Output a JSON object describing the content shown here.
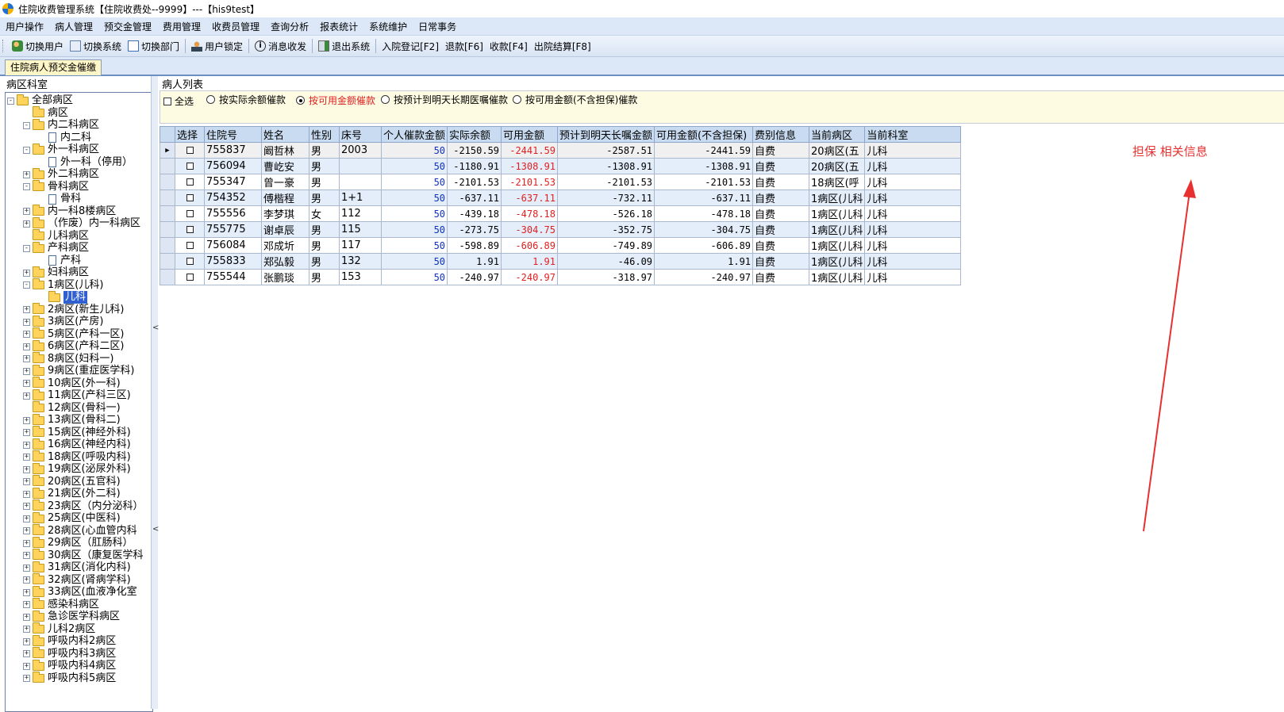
{
  "window": {
    "title": "住院收费管理系统【住院收费处--9999】---【his9test】"
  },
  "menu": [
    "用户操作",
    "病人管理",
    "预交金管理",
    "费用管理",
    "收费员管理",
    "查询分析",
    "报表统计",
    "系统维护",
    "日常事务"
  ],
  "toolbar": {
    "switch_user": "切换用户",
    "switch_system": "切换系统",
    "switch_dept": "切换部门",
    "lock_user": "用户锁定",
    "message": "消息收发",
    "exit_system": "退出系统",
    "admission": "入院登记[F2]",
    "refund": "退款[F6]",
    "charge": "收款[F4]",
    "discharge": "出院结算[F8]"
  },
  "tab": {
    "label": "住院病人预交金催缴"
  },
  "left_panel": {
    "title": "病区科室",
    "tree": [
      {
        "label": "全部病区",
        "level": 0,
        "type": "folder",
        "exp": "−"
      },
      {
        "label": "病区",
        "level": 1,
        "type": "folder",
        "exp": ""
      },
      {
        "label": "内二科病区",
        "level": 1,
        "type": "folder",
        "exp": "−"
      },
      {
        "label": "内二科",
        "level": 2,
        "type": "doc",
        "exp": ""
      },
      {
        "label": "外一科病区",
        "level": 1,
        "type": "folder",
        "exp": "−"
      },
      {
        "label": "外一科（停用）",
        "level": 2,
        "type": "doc",
        "exp": ""
      },
      {
        "label": "外二科病区",
        "level": 1,
        "type": "folder",
        "exp": "+"
      },
      {
        "label": "骨科病区",
        "level": 1,
        "type": "folder",
        "exp": "−"
      },
      {
        "label": "骨科",
        "level": 2,
        "type": "doc",
        "exp": ""
      },
      {
        "label": "内一科8楼病区",
        "level": 1,
        "type": "folder",
        "exp": "+"
      },
      {
        "label": "（作废）内一科病区",
        "level": 1,
        "type": "folder",
        "exp": "+"
      },
      {
        "label": "儿科病区",
        "level": 1,
        "type": "folder",
        "exp": ""
      },
      {
        "label": "产科病区",
        "level": 1,
        "type": "folder",
        "exp": "−"
      },
      {
        "label": "产科",
        "level": 2,
        "type": "doc",
        "exp": ""
      },
      {
        "label": "妇科病区",
        "level": 1,
        "type": "folder",
        "exp": "+"
      },
      {
        "label": "1病区(儿科)",
        "level": 1,
        "type": "folder",
        "exp": "−"
      },
      {
        "label": "儿科",
        "level": 2,
        "type": "sel",
        "exp": ""
      },
      {
        "label": "2病区(新生儿科)",
        "level": 1,
        "type": "folder",
        "exp": "+"
      },
      {
        "label": "3病区(产房)",
        "level": 1,
        "type": "folder",
        "exp": "+"
      },
      {
        "label": "5病区(产科一区)",
        "level": 1,
        "type": "folder",
        "exp": "+"
      },
      {
        "label": "6病区(产科二区)",
        "level": 1,
        "type": "folder",
        "exp": "+"
      },
      {
        "label": "8病区(妇科一)",
        "level": 1,
        "type": "folder",
        "exp": "+"
      },
      {
        "label": "9病区(重症医学科)",
        "level": 1,
        "type": "folder",
        "exp": "+"
      },
      {
        "label": "10病区(外一科)",
        "level": 1,
        "type": "folder",
        "exp": "+"
      },
      {
        "label": "11病区(产科三区)",
        "level": 1,
        "type": "folder",
        "exp": "+"
      },
      {
        "label": "12病区(骨科一)",
        "level": 1,
        "type": "folder",
        "exp": ""
      },
      {
        "label": "13病区(骨科二)",
        "level": 1,
        "type": "folder",
        "exp": "+"
      },
      {
        "label": "15病区(神经外科)",
        "level": 1,
        "type": "folder",
        "exp": "+"
      },
      {
        "label": "16病区(神经内科)",
        "level": 1,
        "type": "folder",
        "exp": "+"
      },
      {
        "label": "18病区(呼吸内科)",
        "level": 1,
        "type": "folder",
        "exp": "+"
      },
      {
        "label": "19病区(泌尿外科)",
        "level": 1,
        "type": "folder",
        "exp": "+"
      },
      {
        "label": "20病区(五官科)",
        "level": 1,
        "type": "folder",
        "exp": "+"
      },
      {
        "label": "21病区(外二科)",
        "level": 1,
        "type": "folder",
        "exp": "+"
      },
      {
        "label": "23病区（内分泌科）",
        "level": 1,
        "type": "folder",
        "exp": "+"
      },
      {
        "label": "25病区(中医科)",
        "level": 1,
        "type": "folder",
        "exp": "+"
      },
      {
        "label": "28病区(心血管内科",
        "level": 1,
        "type": "folder",
        "exp": "+"
      },
      {
        "label": "29病区（肛肠科）",
        "level": 1,
        "type": "folder",
        "exp": "+"
      },
      {
        "label": "30病区（康复医学科",
        "level": 1,
        "type": "folder",
        "exp": "+"
      },
      {
        "label": "31病区(消化内科)",
        "level": 1,
        "type": "folder",
        "exp": "+"
      },
      {
        "label": "32病区(肾病学科)",
        "level": 1,
        "type": "folder",
        "exp": "+"
      },
      {
        "label": "33病区(血液净化室",
        "level": 1,
        "type": "folder",
        "exp": "+"
      },
      {
        "label": "感染科病区",
        "level": 1,
        "type": "folder",
        "exp": "+"
      },
      {
        "label": "急诊医学科病区",
        "level": 1,
        "type": "folder",
        "exp": "+"
      },
      {
        "label": "儿科2病区",
        "level": 1,
        "type": "folder",
        "exp": "+"
      },
      {
        "label": "呼吸内科2病区",
        "level": 1,
        "type": "folder",
        "exp": "+"
      },
      {
        "label": "呼吸内科3病区",
        "level": 1,
        "type": "folder",
        "exp": "+"
      },
      {
        "label": "呼吸内科4病区",
        "level": 1,
        "type": "folder",
        "exp": "+"
      },
      {
        "label": "呼吸内科5病区",
        "level": 1,
        "type": "folder",
        "exp": "+"
      }
    ]
  },
  "right_panel": {
    "title": "病人列表",
    "filters": {
      "select_all": "全选",
      "opt_actual_balance": "按实际余额催款",
      "opt_available_amount": "按可用金额催款",
      "opt_expected_order": "按预计到明天长期医嘱催款",
      "opt_available_no_guarantee": "按可用金额(不含担保)催款",
      "selected": "opt_available_amount"
    },
    "columns": [
      "选择",
      "住院号",
      "姓名",
      "性别",
      "床号",
      "个人催款金额",
      "实际余额",
      "可用金额",
      "预计到明天长嘱金额",
      "可用金额(不含担保)",
      "费别信息",
      "当前病区",
      "当前科室"
    ],
    "rows": [
      {
        "id": "755837",
        "name": "阚哲林",
        "sex": "男",
        "bed": "2003",
        "dun": "50",
        "actual": "-2150.59",
        "avail": "-2441.59",
        "expected": "-2587.51",
        "avail_ng": "-2441.59",
        "fee": "自费",
        "ward": "20病区(五",
        "dept": "儿科"
      },
      {
        "id": "756094",
        "name": "曹屹安",
        "sex": "男",
        "bed": "",
        "dun": "50",
        "actual": "-1180.91",
        "avail": "-1308.91",
        "expected": "-1308.91",
        "avail_ng": "-1308.91",
        "fee": "自费",
        "ward": "20病区(五",
        "dept": "儿科"
      },
      {
        "id": "755347",
        "name": "曾一豪",
        "sex": "男",
        "bed": "",
        "dun": "50",
        "actual": "-2101.53",
        "avail": "-2101.53",
        "expected": "-2101.53",
        "avail_ng": "-2101.53",
        "fee": "自费",
        "ward": "18病区(呼",
        "dept": "儿科"
      },
      {
        "id": "754352",
        "name": "傅楷程",
        "sex": "男",
        "bed": "1+1",
        "dun": "50",
        "actual": "-637.11",
        "avail": "-637.11",
        "expected": "-732.11",
        "avail_ng": "-637.11",
        "fee": "自费",
        "ward": "1病区(儿科",
        "dept": "儿科"
      },
      {
        "id": "755556",
        "name": "李梦琪",
        "sex": "女",
        "bed": "112",
        "dun": "50",
        "actual": "-439.18",
        "avail": "-478.18",
        "expected": "-526.18",
        "avail_ng": "-478.18",
        "fee": "自费",
        "ward": "1病区(儿科",
        "dept": "儿科"
      },
      {
        "id": "755775",
        "name": "谢卓辰",
        "sex": "男",
        "bed": "115",
        "dun": "50",
        "actual": "-273.75",
        "avail": "-304.75",
        "expected": "-352.75",
        "avail_ng": "-304.75",
        "fee": "自费",
        "ward": "1病区(儿科",
        "dept": "儿科"
      },
      {
        "id": "756084",
        "name": "邓成圻",
        "sex": "男",
        "bed": "117",
        "dun": "50",
        "actual": "-598.89",
        "avail": "-606.89",
        "expected": "-749.89",
        "avail_ng": "-606.89",
        "fee": "自费",
        "ward": "1病区(儿科",
        "dept": "儿科"
      },
      {
        "id": "755833",
        "name": "郑弘毅",
        "sex": "男",
        "bed": "132",
        "dun": "50",
        "actual": "1.91",
        "avail": "1.91",
        "expected": "-46.09",
        "avail_ng": "1.91",
        "fee": "自费",
        "ward": "1病区(儿科",
        "dept": "儿科"
      },
      {
        "id": "755544",
        "name": "张鹏琰",
        "sex": "男",
        "bed": "153",
        "dun": "50",
        "actual": "-240.97",
        "avail": "-240.97",
        "expected": "-318.97",
        "avail_ng": "-240.97",
        "fee": "自费",
        "ward": "1病区(儿科",
        "dept": "儿科"
      }
    ]
  },
  "annotation": {
    "text": "担保 相关信息",
    "color": "#e83030"
  },
  "colors": {
    "menubar": "#dce8f7",
    "filter_bg": "#fdfbe2",
    "header_bg": "#c9dbf1",
    "alt_row": "#e4eefb",
    "negative": "#e02020",
    "dun_amount": "#1030c0",
    "selected_tree": "#2f5fd0"
  }
}
